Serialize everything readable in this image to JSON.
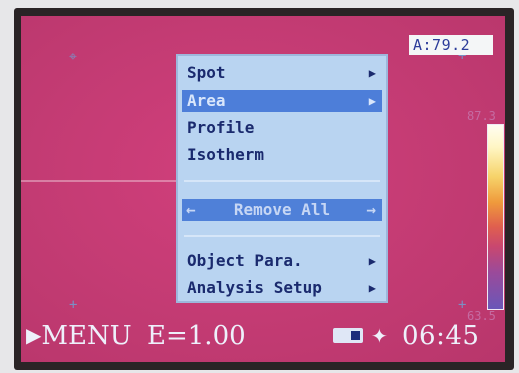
{
  "readout": "A:79.2",
  "scale": {
    "max": "87.3",
    "min": "63.5"
  },
  "menu": {
    "items": [
      {
        "label": "Spot",
        "has_submenu": true,
        "state": "normal"
      },
      {
        "label": "Area",
        "has_submenu": true,
        "state": "selected"
      },
      {
        "label": "Profile",
        "has_submenu": false,
        "state": "normal"
      },
      {
        "label": "Isotherm",
        "has_submenu": false,
        "state": "normal"
      }
    ],
    "remove_all": "Remove All",
    "lower_items": [
      {
        "label": "Object Para.",
        "has_submenu": true
      },
      {
        "label": "Analysis Setup",
        "has_submenu": true
      }
    ]
  },
  "status": {
    "menu_label": "MENU",
    "emissivity": "E=1.00",
    "time": "06:45"
  },
  "icons": {
    "submenu": "right-triangle-icon",
    "menu_key": "play-triangle-icon",
    "battery": "battery-icon",
    "pin": "pin-icon",
    "crosshair": "crosshair-icon"
  },
  "colors": {
    "thermal_background": "#c33b73",
    "menu_background": "#b9d4f1",
    "menu_highlight": "#4d7ed9",
    "menu_text": "#1a2a6e",
    "status_text": "#eef0fb"
  }
}
